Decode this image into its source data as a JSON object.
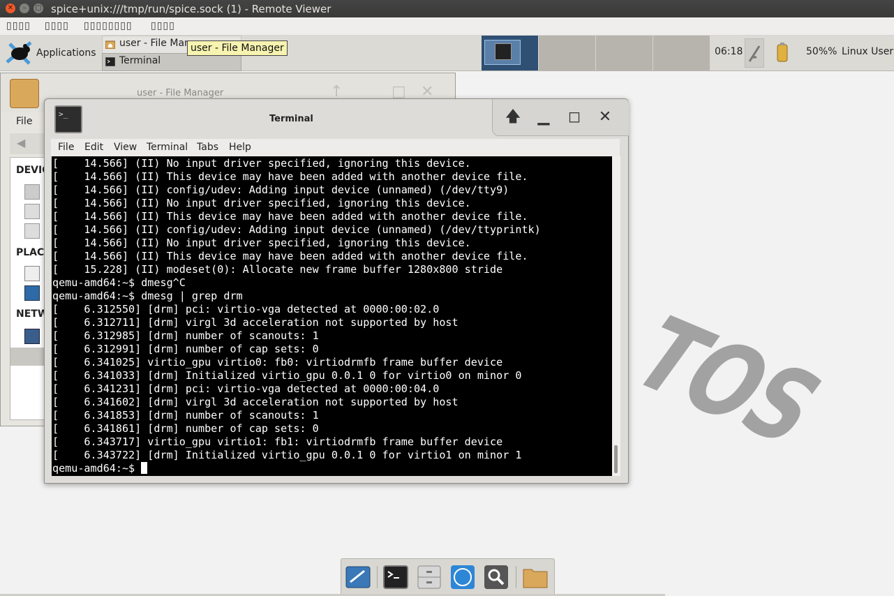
{
  "host": {
    "title": "spice+unix:///tmp/run/spice.sock (1) - Remote Viewer",
    "menu": [
      "▯▯▯▯",
      "▯▯▯▯",
      "▯▯▯▯▯▯▯▯",
      "▯▯▯▯"
    ]
  },
  "panel": {
    "applications_label": "Applications",
    "tasks": [
      {
        "label": "user - File Manager",
        "icon": "home-folder-icon"
      },
      {
        "label": "Terminal",
        "icon": "terminal-icon"
      }
    ],
    "tooltip": "user - File Manager",
    "clock": "06:18",
    "volume": "50%%",
    "user": "Linux User"
  },
  "file_manager": {
    "title": "user - File Manager",
    "menu_file": "File",
    "sections": [
      "DEVIC",
      "PLAC",
      "NETW"
    ]
  },
  "terminal": {
    "title": "Terminal",
    "menu": [
      "File",
      "Edit",
      "View",
      "Terminal",
      "Tabs",
      "Help"
    ],
    "lines": [
      "[    14.566] (II) No input driver specified, ignoring this device.",
      "[    14.566] (II) This device may have been added with another device file.",
      "[    14.566] (II) config/udev: Adding input device (unnamed) (/dev/tty9)",
      "[    14.566] (II) No input driver specified, ignoring this device.",
      "[    14.566] (II) This device may have been added with another device file.",
      "[    14.566] (II) config/udev: Adding input device (unnamed) (/dev/ttyprintk)",
      "[    14.566] (II) No input driver specified, ignoring this device.",
      "[    14.566] (II) This device may have been added with another device file.",
      "[    15.228] (II) modeset(0): Allocate new frame buffer 1280x800 stride",
      "qemu-amd64:~$ dmesg^C",
      "qemu-amd64:~$ dmesg | grep drm",
      "[    6.312550] [drm] pci: virtio-vga detected at 0000:00:02.0",
      "[    6.312711] [drm] virgl 3d acceleration not supported by host",
      "[    6.312985] [drm] number of scanouts: 1",
      "[    6.312991] [drm] number of cap sets: 0",
      "[    6.341025] virtio_gpu virtio0: fb0: virtiodrmfb frame buffer device",
      "[    6.341033] [drm] Initialized virtio_gpu 0.0.1 0 for virtio0 on minor 0",
      "[    6.341231] [drm] pci: virtio-vga detected at 0000:00:04.0",
      "[    6.341602] [drm] virgl 3d acceleration not supported by host",
      "[    6.341853] [drm] number of scanouts: 1",
      "[    6.341861] [drm] number of cap sets: 0",
      "[    6.343717] virtio_gpu virtio1: fb1: virtiodrmfb frame buffer device",
      "[    6.343722] [drm] Initialized virtio_gpu 0.0.1 0 for virtio1 on minor 1"
    ],
    "prompt": "qemu-amd64:~$ "
  },
  "desktop": {
    "logo_text": "TOS"
  },
  "dock": {
    "items": [
      "settings-icon",
      "terminal-icon",
      "file-cabinet-icon",
      "web-browser-icon",
      "search-icon",
      "folder-icon"
    ]
  }
}
